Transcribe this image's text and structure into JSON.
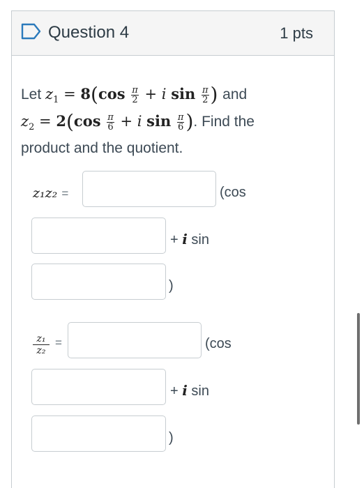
{
  "question": {
    "title": "Question 4",
    "points": "1 pts"
  },
  "prompt": {
    "let_word": "Let",
    "and_word": "and",
    "find_text": ". Find the",
    "line3": "product and the quotient.",
    "z1": {
      "var": "z",
      "sub": "1",
      "coef": "8",
      "angle_num": "π",
      "angle_den": "2"
    },
    "z2": {
      "var": "z",
      "sub": "2",
      "coef": "2",
      "angle_num": "π",
      "angle_den": "6"
    },
    "cos_word": "cos",
    "sin_word": "sin",
    "i_sym": "i",
    "plus": "+",
    "equals": "="
  },
  "product": {
    "lhs": "z₁z₂",
    "equals": "=",
    "cos_label": "(cos",
    "isin_plus": "+",
    "isin_i": "i",
    "isin_sin": "sin",
    "close": ")",
    "modulus_value": "",
    "cos_arg_value": "",
    "sin_arg_value": ""
  },
  "quotient": {
    "num": "z₁",
    "den": "z₂",
    "equals": "=",
    "cos_label": "(cos",
    "isin_plus": "+",
    "isin_i": "i",
    "isin_sin": "sin",
    "close": ")",
    "modulus_value": "",
    "cos_arg_value": "",
    "sin_arg_value": ""
  }
}
